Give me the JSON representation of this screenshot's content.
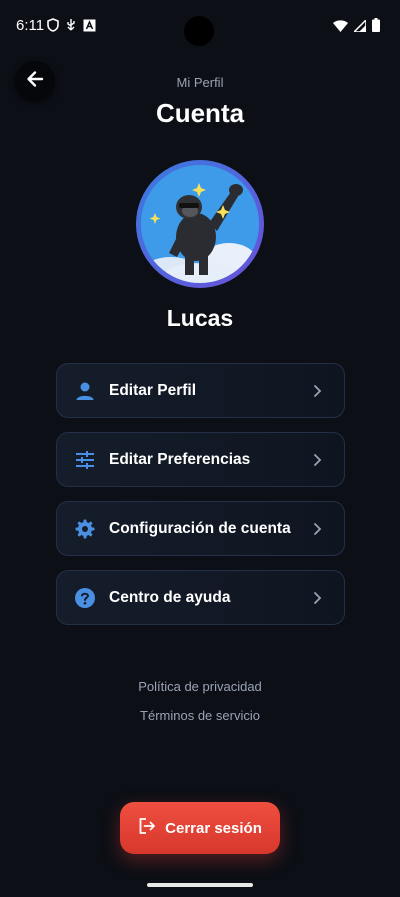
{
  "status_bar": {
    "time": "6:11"
  },
  "header": {
    "subtitle": "Mi Perfil",
    "title": "Cuenta"
  },
  "user": {
    "name": "Lucas"
  },
  "menu": [
    {
      "label": "Editar Perfil",
      "icon": "person-icon"
    },
    {
      "label": "Editar Preferencias",
      "icon": "sliders-icon"
    },
    {
      "label": "Configuración de cuenta",
      "icon": "gear-icon"
    },
    {
      "label": "Centro de ayuda",
      "icon": "help-circle-icon"
    }
  ],
  "footer": {
    "privacy": "Política de privacidad",
    "terms": "Términos de servicio"
  },
  "logout": {
    "label": "Cerrar sesión"
  },
  "colors": {
    "accent": "#4a90e2",
    "danger": "#e5453a",
    "background": "#0c0f16"
  }
}
